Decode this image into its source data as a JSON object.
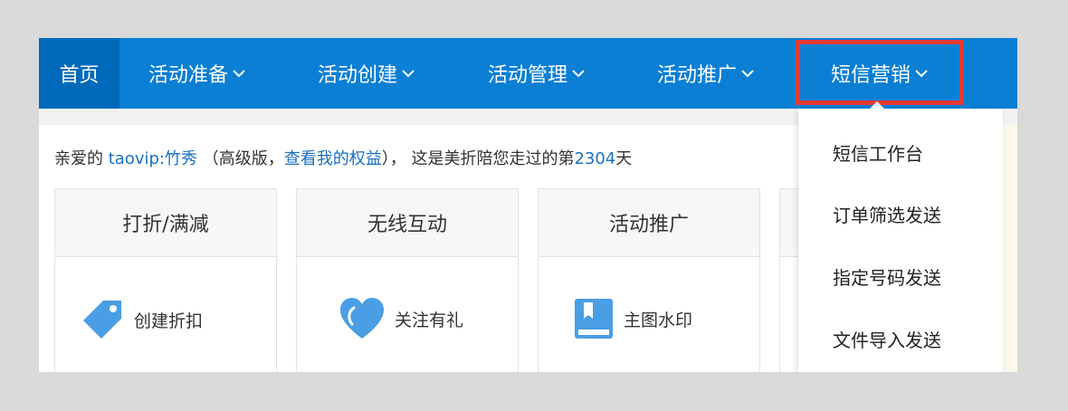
{
  "nav": {
    "home": "首页",
    "items": [
      {
        "label": "活动准备"
      },
      {
        "label": "活动创建"
      },
      {
        "label": "活动管理"
      },
      {
        "label": "活动推广"
      },
      {
        "label": "短信营销"
      }
    ]
  },
  "greeting": {
    "prefix": "亲爱的 ",
    "user": "taovip:竹秀",
    "middle": " （高级版，",
    "rights_link": "查看我的权益",
    "suffix": "）， 这是美折陪您走过的第",
    "days": "2304",
    "day_unit": "天"
  },
  "cards": [
    {
      "title": "打折/满减",
      "action": "创建折扣",
      "icon": "tag-icon"
    },
    {
      "title": "无线互动",
      "action": "关注有礼",
      "icon": "heart-icon"
    },
    {
      "title": "活动推广",
      "action": "主图水印",
      "icon": "bookmark-book-icon"
    }
  ],
  "dropdown": {
    "items": [
      {
        "label": "短信工作台"
      },
      {
        "label": "订单筛选发送"
      },
      {
        "label": "指定号码发送"
      },
      {
        "label": "文件导入发送"
      }
    ]
  },
  "colors": {
    "nav_bg": "#0a7fd4",
    "nav_home_bg": "#0069b9",
    "highlight": "#e53935",
    "link": "#1a6fc2",
    "icon": "#4a9ee3"
  }
}
